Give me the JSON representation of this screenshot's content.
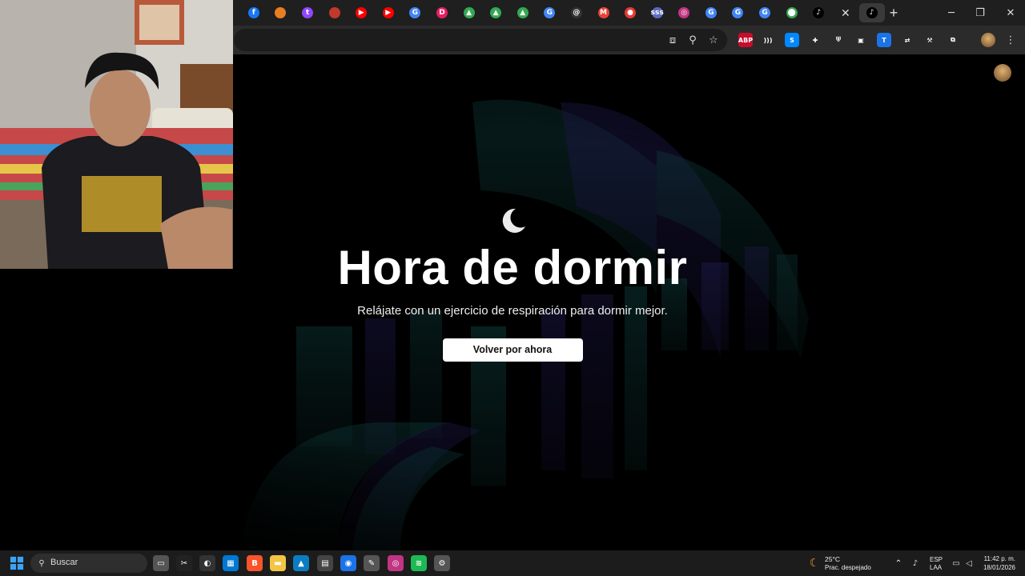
{
  "browser": {
    "tabs": [
      {
        "icon": "facebook-icon",
        "glyph": "f",
        "color": "#1877f2"
      },
      {
        "icon": "app-icon",
        "glyph": "",
        "color": "#e67e22"
      },
      {
        "icon": "twitch-icon",
        "glyph": "t",
        "color": "#9146ff"
      },
      {
        "icon": "app-icon",
        "glyph": "",
        "color": "#c0392b"
      },
      {
        "icon": "youtube-icon",
        "glyph": "▶",
        "color": "#ff0000"
      },
      {
        "icon": "youtube-icon",
        "glyph": "▶",
        "color": "#ff0000"
      },
      {
        "icon": "google-icon",
        "glyph": "G",
        "color": "#4285f4"
      },
      {
        "icon": "app-icon",
        "glyph": "D",
        "color": "#e91e63"
      },
      {
        "icon": "drive-icon",
        "glyph": "▲",
        "color": "#34a853"
      },
      {
        "icon": "drive-icon",
        "glyph": "▲",
        "color": "#34a853"
      },
      {
        "icon": "drive-icon",
        "glyph": "▲",
        "color": "#34a853"
      },
      {
        "icon": "google-icon",
        "glyph": "G",
        "color": "#4285f4"
      },
      {
        "icon": "threads-icon",
        "glyph": "@",
        "color": "#333333"
      },
      {
        "icon": "gmail-icon",
        "glyph": "M",
        "color": "#ea4335"
      },
      {
        "icon": "app-icon",
        "glyph": "●",
        "color": "#e53935"
      },
      {
        "icon": "app-icon",
        "glyph": "sss",
        "color": "#5c6bc0"
      },
      {
        "icon": "instagram-icon",
        "glyph": "◎",
        "color": "#c13584"
      },
      {
        "icon": "google-icon",
        "glyph": "G",
        "color": "#4285f4"
      },
      {
        "icon": "google-icon",
        "glyph": "G",
        "color": "#4285f4"
      },
      {
        "icon": "google-icon",
        "glyph": "G",
        "color": "#4285f4"
      },
      {
        "icon": "maps-icon",
        "glyph": "⬤",
        "color": "#34a853"
      },
      {
        "icon": "tiktok-icon",
        "glyph": "♪",
        "color": "#000000"
      }
    ],
    "active_tab": {
      "icon": "tiktok-icon",
      "glyph": "♪"
    },
    "new_tab_label": "+",
    "toolbar_icons": [
      "cast-icon",
      "zoom-icon",
      "bookmark-star-icon"
    ],
    "extensions": [
      {
        "name": "abp-extension-icon",
        "label": "ABP",
        "color": "#c70d2c"
      },
      {
        "name": "wave-extension-icon",
        "label": ")))",
        "color": "#2b2b2b"
      },
      {
        "name": "shazam-extension-icon",
        "label": "S",
        "color": "#0088ff"
      },
      {
        "name": "puzzle-extension-icon",
        "label": "✚",
        "color": "#2b2b2b"
      },
      {
        "name": "shield-extension-icon",
        "label": "⛨",
        "color": "#2b2b2b"
      },
      {
        "name": "notes-extension-icon",
        "label": "▣",
        "color": "#2b2b2b"
      },
      {
        "name": "translate-extension-icon",
        "label": "T",
        "color": "#1a73e8"
      },
      {
        "name": "link-extension-icon",
        "label": "⇄",
        "color": "#2b2b2b"
      },
      {
        "name": "tools-extension-icon",
        "label": "⚒",
        "color": "#2b2b2b"
      },
      {
        "name": "extensions-icon",
        "label": "⧉",
        "color": "#2b2b2b"
      }
    ]
  },
  "page": {
    "title": "Hora de dormir",
    "subtitle": "Relájate con un ejercicio de respiración para dormir mejor.",
    "button_label": "Volver por ahora"
  },
  "taskbar": {
    "search_placeholder": "Buscar",
    "weather_temp": "25°C",
    "weather_desc": "Prac. despejado",
    "lang_top": "ESP",
    "lang_bottom": "LAA",
    "time": "11:42 p. m.",
    "date": "18/01/2026",
    "apps": [
      {
        "name": "task-view-icon",
        "glyph": "▭",
        "color": "#555555"
      },
      {
        "name": "capcut-icon",
        "glyph": "✂",
        "color": "#222222"
      },
      {
        "name": "app-icon",
        "glyph": "◐",
        "color": "#333333"
      },
      {
        "name": "store-icon",
        "glyph": "▦",
        "color": "#0078d4"
      },
      {
        "name": "brave-icon",
        "glyph": "B",
        "color": "#fb542b"
      },
      {
        "name": "file-explorer-icon",
        "glyph": "▬",
        "color": "#f4c542"
      },
      {
        "name": "photos-icon",
        "glyph": "▲",
        "color": "#0a7cc1"
      },
      {
        "name": "calculator-icon",
        "glyph": "▤",
        "color": "#444444"
      },
      {
        "name": "chrome-icon",
        "glyph": "◉",
        "color": "#1a73e8"
      },
      {
        "name": "snipping-icon",
        "glyph": "✎",
        "color": "#555555"
      },
      {
        "name": "instagram-icon",
        "glyph": "◎",
        "color": "#c13584"
      },
      {
        "name": "spotify-icon",
        "glyph": "≋",
        "color": "#1db954"
      },
      {
        "name": "settings-icon",
        "glyph": "⚙",
        "color": "#555555"
      }
    ]
  },
  "colors": {
    "accent_teal": "#0e3b3b",
    "accent_purple": "#1d1848"
  }
}
